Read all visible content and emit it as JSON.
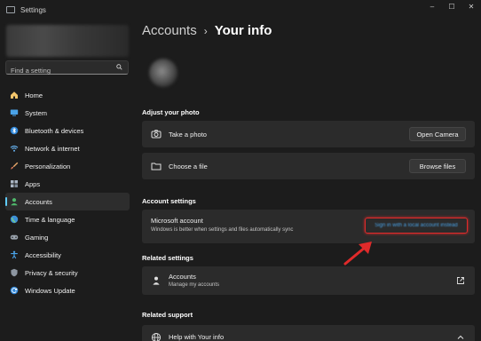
{
  "window": {
    "title": "Settings",
    "controls": {
      "minimize": "–",
      "maximize": "☐",
      "close": "✕"
    }
  },
  "sidebar": {
    "search": {
      "placeholder": "Find a setting"
    },
    "items": [
      {
        "label": "Home",
        "icon": "home-icon",
        "active": false
      },
      {
        "label": "System",
        "icon": "system-icon",
        "active": false
      },
      {
        "label": "Bluetooth & devices",
        "icon": "bluetooth-icon",
        "active": false
      },
      {
        "label": "Network & internet",
        "icon": "wifi-icon",
        "active": false
      },
      {
        "label": "Personalization",
        "icon": "brush-icon",
        "active": false
      },
      {
        "label": "Apps",
        "icon": "apps-icon",
        "active": false
      },
      {
        "label": "Accounts",
        "icon": "accounts-icon",
        "active": true
      },
      {
        "label": "Time & language",
        "icon": "globe-icon",
        "active": false
      },
      {
        "label": "Gaming",
        "icon": "gaming-icon",
        "active": false
      },
      {
        "label": "Accessibility",
        "icon": "accessibility-icon",
        "active": false
      },
      {
        "label": "Privacy & security",
        "icon": "shield-icon",
        "active": false
      },
      {
        "label": "Windows Update",
        "icon": "update-icon",
        "active": false
      }
    ]
  },
  "main": {
    "breadcrumb": {
      "parent": "Accounts",
      "separator": "›",
      "current": "Your info"
    },
    "adjust_photo": {
      "title": "Adjust your photo",
      "take_photo": {
        "label": "Take a photo",
        "button": "Open Camera"
      },
      "choose_file": {
        "label": "Choose a file",
        "button": "Browse files"
      }
    },
    "account_settings": {
      "title": "Account settings",
      "microsoft_account": {
        "label": "Microsoft account",
        "description": "Windows is better when settings and files automatically sync",
        "link": "Sign in with a local account instead"
      }
    },
    "related_settings": {
      "title": "Related settings",
      "accounts": {
        "label": "Accounts",
        "description": "Manage my accounts"
      }
    },
    "related_support": {
      "title": "Related support",
      "help": {
        "label": "Help with Your info"
      }
    }
  },
  "colors": {
    "background": "#1c1c1c",
    "card": "#2b2b2b",
    "accent": "#60cdff",
    "highlight": "#e02a2a",
    "link": "#4aa3e8"
  }
}
